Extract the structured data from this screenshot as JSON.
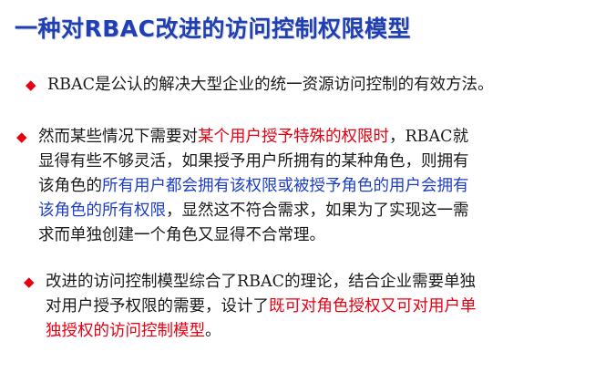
{
  "slide": {
    "title": "一种对RBAC改进的访问控制权限模型",
    "marker_glyph": "◆",
    "colors": {
      "title": "#1f3fb5",
      "marker": "#e60012",
      "highlight_red": "#e60012",
      "highlight_blue": "#1e3ec8",
      "body": "#1a1a1a"
    },
    "bullets": [
      {
        "line1": "RBAC是公认的解决大型企业的统一资源访问控制的有效方法。"
      },
      {
        "l1_a": "然而某些情况下需要对",
        "l1_red": "某个用户授予特殊的权限时",
        "l1_b": "，RBAC就",
        "l2": "显得有些不够灵活，如果授予用户所拥有的某种角色，则拥有",
        "l3_a": "该角色的",
        "l3_blue": "所有用户都会拥有该权限或被授予角色的用户会拥有",
        "l4_blue": "该角色的所有权限",
        "l4_b": "，显然这不符合需求，如果为了实现这一需",
        "l5": "求而单独创建一个角色又显得不合常理。"
      },
      {
        "l1": "改进的访问控制模型综合了RBAC的理论，结合企业需要单独",
        "l2_a": "对用户授予权限的需要，设计了",
        "l2_red": "既可对角色授权又可对用户单",
        "l3_red": "独授权的访问控制模型",
        "l3_b": "。"
      }
    ]
  }
}
